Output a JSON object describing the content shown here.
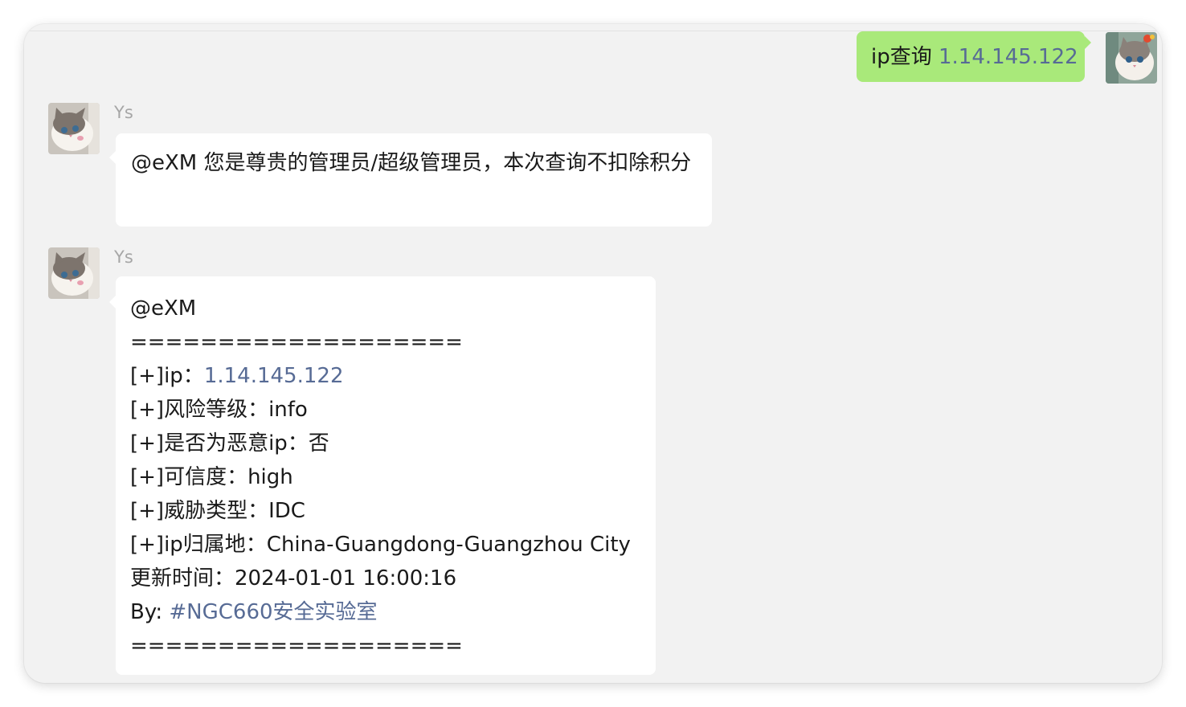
{
  "outgoing": {
    "text": "ip查询 ",
    "ip_link": "1.14.145.122"
  },
  "messages": [
    {
      "sender": "Ys",
      "text": "@eXM 您是尊贵的管理员/超级管理员，本次查询不扣除积分"
    },
    {
      "sender": "Ys",
      "mention": "@eXM",
      "separator": "===================",
      "ip_label": "[+]ip：",
      "ip_value": "1.14.145.122",
      "risk": "[+]风险等级：info",
      "malicious": "[+]是否为恶意ip：否",
      "confidence": "[+]可信度：high",
      "threat_type": "[+]威胁类型：IDC",
      "location": "[+]ip归属地：China-Guangdong-Guangzhou City",
      "updated": "更新时间：2024-01-01 16:00:16",
      "by_label": "By: ",
      "by_link": "#NGC660安全实验室",
      "separator_end": "==================="
    }
  ],
  "icons": {
    "avatar": "cat-avatar-icon"
  },
  "colors": {
    "chat_background": "#f2f2f2",
    "outgoing_bubble": "#a9e97a",
    "incoming_bubble": "#ffffff",
    "link": "#576b95",
    "sender_name": "#a6a6a6"
  }
}
